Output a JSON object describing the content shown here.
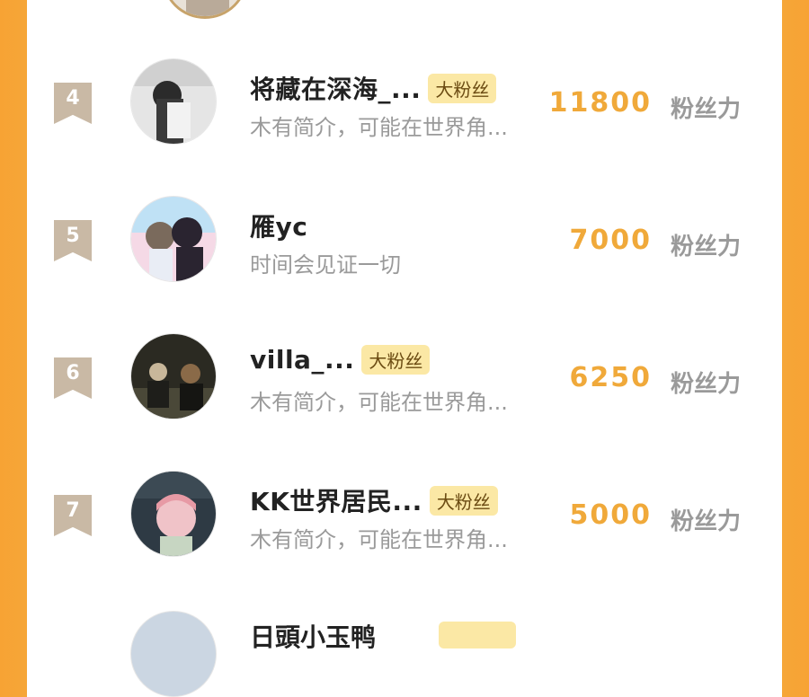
{
  "unit": "粉丝力",
  "rows": [
    {
      "rank": "4",
      "name": "将藏在深海_...",
      "badge": "大粉丝",
      "bio": "木有简介，可能在世界角...",
      "score": "11800"
    },
    {
      "rank": "5",
      "name": "雁yc",
      "badge": "",
      "bio": "时间会见证一切",
      "score": "7000"
    },
    {
      "rank": "6",
      "name": "villa_...",
      "badge": "大粉丝",
      "bio": "木有简介，可能在世界角...",
      "score": "6250"
    },
    {
      "rank": "7",
      "name": "KK世界居民...",
      "badge": "大粉丝",
      "bio": "木有简介，可能在世界角...",
      "score": "5000"
    }
  ],
  "next_row": {
    "name": "日頭小玉鸭"
  }
}
